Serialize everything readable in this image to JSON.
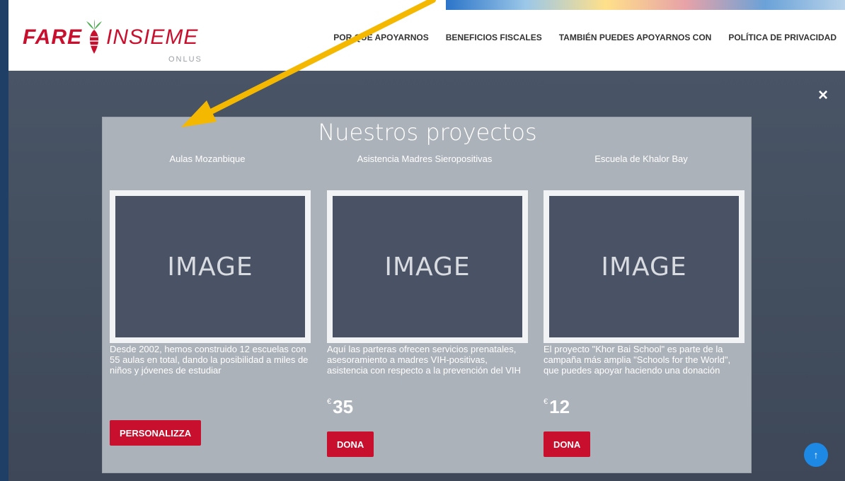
{
  "brand": {
    "name_part1": "FARE",
    "name_part2": "INSIEME",
    "sub": "ONLUS",
    "color": "#c8102e"
  },
  "nav": {
    "items": [
      {
        "label": "POR QUÉ APOYARNOS"
      },
      {
        "label": "BENEFICIOS FISCALES"
      },
      {
        "label": "TAMBIÉN PUEDES APOYARNOS CON"
      },
      {
        "label": "POLÍTICA DE PRIVACIDAD"
      }
    ]
  },
  "modal": {
    "title": "Nuestros proyectos",
    "close_icon": "close-icon",
    "placeholder_text": "IMAGE",
    "cards": [
      {
        "title": "Aulas Mozanbique",
        "description": "Desde 2002, hemos construido 12 escuelas con 55 aulas en total, dando la posibilidad a miles de niños y jóvenes de estudiar",
        "button": "PERSONALIZZA"
      },
      {
        "title": "Asistencia Madres Sieropositivas",
        "description": "Aquí las parteras ofrecen servicios prenatales, asesoramiento a madres VIH-positivas, asistencia con respecto a la prevención del VIH",
        "currency": "€",
        "amount": "35",
        "button": "DONA"
      },
      {
        "title": "Escuela de Khalor Bay",
        "description": "El proyecto \"Khor Bai School\" es parte de la campaña más amplia \"Schools for the World\", que puedes apoyar haciendo una donación",
        "currency": "€",
        "amount": "12",
        "button": "DONA"
      }
    ]
  },
  "scroll_top": {
    "icon": "arrow-up-icon",
    "glyph": "↑",
    "color": "#1e88e5"
  },
  "close": {
    "glyph": "×"
  },
  "colors": {
    "accent": "#c8102e",
    "overlay": "#495566",
    "modal_bg": "#acb2ba",
    "annotation_arrow": "#f5b800"
  }
}
